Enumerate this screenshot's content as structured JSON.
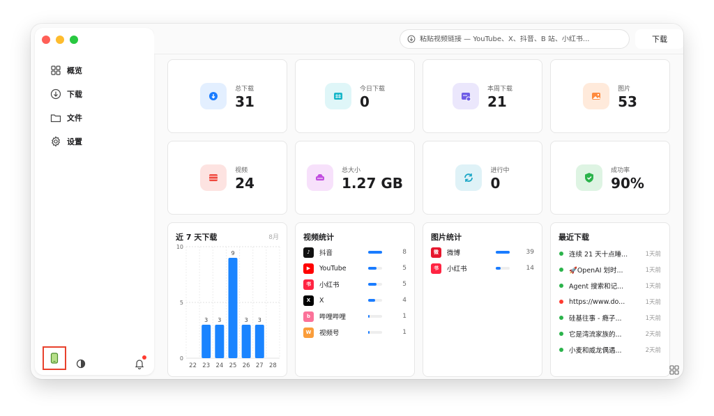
{
  "sidebar": {
    "items": [
      {
        "label": "概览",
        "icon": "grid-icon"
      },
      {
        "label": "下载",
        "icon": "download-circle-icon"
      },
      {
        "label": "文件",
        "icon": "folder-icon"
      },
      {
        "label": "设置",
        "icon": "gear-icon"
      }
    ]
  },
  "toolbar": {
    "url_placeholder": "粘贴视频链接 — YouTube、X、抖音、B 站、小红书...",
    "download_label": "下载"
  },
  "stats": [
    {
      "label": "总下载",
      "value": "31",
      "color": "#1a7cff",
      "bg": "#e3efff"
    },
    {
      "label": "今日下载",
      "value": "0",
      "color": "#19b7c9",
      "bg": "#dff6f8"
    },
    {
      "label": "本周下载",
      "value": "21",
      "color": "#6e5ce6",
      "bg": "#ebe7fc"
    },
    {
      "label": "图片",
      "value": "53",
      "color": "#ff8a3d",
      "bg": "#ffeadb"
    },
    {
      "label": "视频",
      "value": "24",
      "color": "#f0483e",
      "bg": "#fde3e1"
    },
    {
      "label": "总大小",
      "value": "1.27 GB",
      "color": "#c24de0",
      "bg": "#f7e1fb"
    },
    {
      "label": "进行中",
      "value": "0",
      "color": "#1aa6c6",
      "bg": "#dff2f7"
    },
    {
      "label": "成功率",
      "value": "90%",
      "color": "#2bb34b",
      "bg": "#def4e3"
    }
  ],
  "chart_panel": {
    "title": "近 7 天下载",
    "month": "8月"
  },
  "chart_data": {
    "type": "bar",
    "categories": [
      "22",
      "23",
      "24",
      "25",
      "26",
      "27",
      "28"
    ],
    "values": [
      0,
      3,
      3,
      9,
      3,
      3,
      0
    ],
    "value_labels": [
      "",
      "3",
      "3",
      "9",
      "3",
      "3",
      ""
    ],
    "yticks": [
      "10",
      "5",
      "0"
    ],
    "ylim": [
      0,
      10
    ],
    "title": "近 7 天下载",
    "xlabel": "",
    "ylabel": "",
    "grid": true
  },
  "video_stats": {
    "title": "视频统计",
    "rows": [
      {
        "name": "抖音",
        "count": "8",
        "share": 1.0,
        "icon": "tiktok-icon",
        "color": "#111111",
        "glyph": "♪"
      },
      {
        "name": "YouTube",
        "count": "5",
        "share": 0.62,
        "icon": "youtube-icon",
        "color": "#ff0000",
        "glyph": "▶"
      },
      {
        "name": "小红书",
        "count": "5",
        "share": 0.62,
        "icon": "xiaohongshu-icon",
        "color": "#ff2442",
        "glyph": "书"
      },
      {
        "name": "X",
        "count": "4",
        "share": 0.5,
        "icon": "x-icon",
        "color": "#000000",
        "glyph": "X"
      },
      {
        "name": "哔哩哔哩",
        "count": "1",
        "share": 0.12,
        "icon": "bilibili-icon",
        "color": "#fb7299",
        "glyph": "b"
      },
      {
        "name": "视频号",
        "count": "1",
        "share": 0.12,
        "icon": "channels-icon",
        "color": "#fa9d3b",
        "glyph": "W"
      }
    ]
  },
  "image_stats": {
    "title": "图片统计",
    "rows": [
      {
        "name": "微博",
        "count": "39",
        "share": 1.0,
        "icon": "weibo-icon",
        "color": "#e6162d",
        "glyph": "微"
      },
      {
        "name": "小红书",
        "count": "14",
        "share": 0.36,
        "icon": "xiaohongshu-icon",
        "color": "#ff2442",
        "glyph": "书"
      }
    ]
  },
  "recent": {
    "title": "最近下载",
    "items": [
      {
        "text": "连续 21 天十点睡...",
        "ago": "1天前",
        "status": "#2bb34b"
      },
      {
        "text": "🚀OpenAI 划时...",
        "ago": "1天前",
        "status": "#2bb34b"
      },
      {
        "text": "Agent 搜索和记...",
        "ago": "1天前",
        "status": "#2bb34b"
      },
      {
        "text": "https://www.do...",
        "ago": "1天前",
        "status": "#ff3b30"
      },
      {
        "text": "硅基往事 - 瘾子...",
        "ago": "1天前",
        "status": "#2bb34b"
      },
      {
        "text": "它是湾流家族的...",
        "ago": "2天前",
        "status": "#2bb34b"
      },
      {
        "text": "小麦和威龙偶遇...",
        "ago": "2天前",
        "status": "#2bb34b"
      }
    ]
  }
}
